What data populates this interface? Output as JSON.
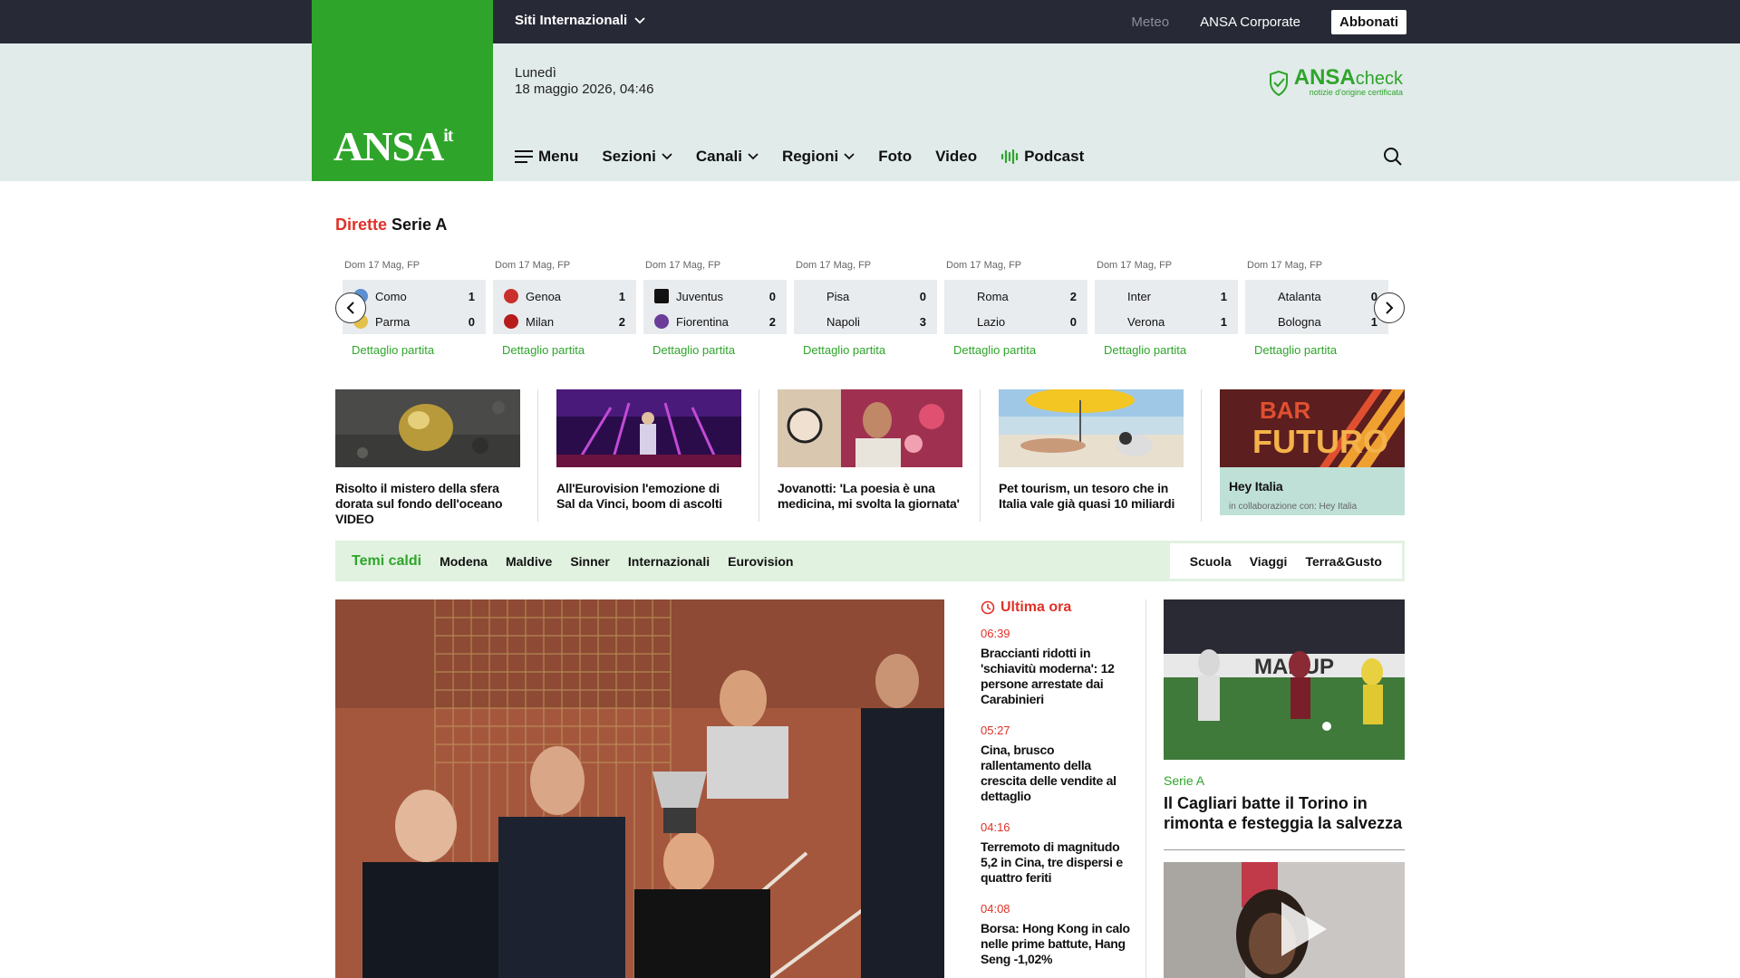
{
  "topbar": {
    "siti": "Siti Internazionali",
    "meteo": "Meteo",
    "corporate": "ANSA Corporate",
    "abbonati": "Abbonati"
  },
  "header": {
    "logo": "ANSA",
    "logo_sup": "it",
    "weekday": "Lunedì",
    "date": "18 maggio 2026, 04:46",
    "ansacheck_bold": "ANSA",
    "ansacheck_light": "check",
    "ansacheck_sub": "notizie d'origine certificata"
  },
  "nav": {
    "menu": "Menu",
    "sezioni": "Sezioni",
    "canali": "Canali",
    "regioni": "Regioni",
    "foto": "Foto",
    "video": "Video",
    "podcast": "Podcast"
  },
  "dirette": {
    "red": "Dirette",
    "black": "Serie A",
    "matches": [
      {
        "when": "Dom 17 Mag, FP",
        "home": "Como",
        "hs": "1",
        "away": "Parma",
        "as": "0",
        "link": "Dettaglio partita"
      },
      {
        "when": "Dom 17 Mag, FP",
        "home": "Genoa",
        "hs": "1",
        "away": "Milan",
        "as": "2",
        "link": "Dettaglio partita"
      },
      {
        "when": "Dom 17 Mag, FP",
        "home": "Juventus",
        "hs": "0",
        "away": "Fiorentina",
        "as": "2",
        "link": "Dettaglio partita"
      },
      {
        "when": "Dom 17 Mag, FP",
        "home": "Pisa",
        "hs": "0",
        "away": "Napoli",
        "as": "3",
        "link": "Dettaglio partita"
      },
      {
        "when": "Dom 17 Mag, FP",
        "home": "Roma",
        "hs": "2",
        "away": "Lazio",
        "as": "0",
        "link": "Dettaglio partita"
      },
      {
        "when": "Dom 17 Mag, FP",
        "home": "Inter",
        "hs": "1",
        "away": "Verona",
        "as": "1",
        "link": "Dettaglio partita"
      },
      {
        "when": "Dom 17 Mag, FP",
        "home": "Atalanta",
        "hs": "0",
        "away": "Bologna",
        "as": "1",
        "link": "Dettaglio partita"
      }
    ]
  },
  "cards": [
    {
      "title": "Risolto il mistero della sfera dorata sul fondo dell'oceano VIDEO"
    },
    {
      "title": "All'Eurovision l'emozione di Sal da Vinci, boom di ascolti"
    },
    {
      "title": "Jovanotti: 'La poesia è una medicina, mi svolta la giornata'"
    },
    {
      "title": "Pet tourism, un tesoro che in Italia vale già quasi 10 miliardi"
    },
    {
      "title": "Hey Italia",
      "collab": "in collaborazione con: Hey Italia",
      "bar": "BAR",
      "futuro": "FUTURO"
    }
  ],
  "temi": {
    "label": "Temi caldi",
    "items": [
      "Modena",
      "Maldive",
      "Sinner",
      "Internazionali",
      "Eurovision"
    ],
    "right": [
      "Scuola",
      "Viaggi",
      "Terra&Gusto"
    ]
  },
  "ultima": {
    "title": "Ultima ora",
    "entries": [
      {
        "time": "06:39",
        "headline": "Braccianti ridotti in 'schiavitù moderna': 12 persone arrestate dai Carabinieri"
      },
      {
        "time": "05:27",
        "headline": "Cina, brusco rallentamento della crescita delle vendite al dettaglio"
      },
      {
        "time": "04:16",
        "headline": "Terremoto di magnitudo 5,2 in Cina, tre dispersi e quattro feriti"
      },
      {
        "time": "04:08",
        "headline": "Borsa: Hong Kong in calo nelle prime battute, Hang Seng -1,02%"
      }
    ]
  },
  "sport": {
    "category": "Serie A",
    "headline": "Il Cagliari batte il Torino in rimonta e festeggia la salvezza",
    "banner": "MAKUP"
  },
  "colors": {
    "brand_green": "#2ea52a",
    "accent_red": "#e03127",
    "topbar": "#272a36",
    "header_band": "#e1ebea"
  }
}
